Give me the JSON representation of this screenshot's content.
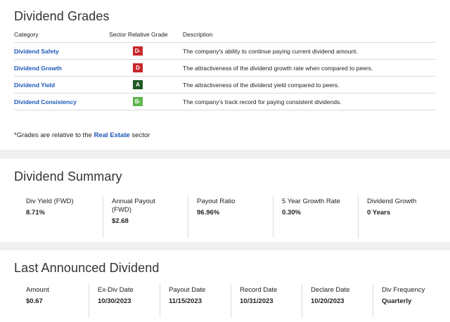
{
  "grades": {
    "title": "Dividend Grades",
    "headers": {
      "category": "Category",
      "grade": "Sector Relative Grade",
      "description": "Description"
    },
    "rows": [
      {
        "category": "Dividend Safety",
        "grade": "D-",
        "color": "#c8262b",
        "description": "The company's ability to continue paying current dividend amount."
      },
      {
        "category": "Dividend Growth",
        "grade": "D",
        "color": "#c8262b",
        "description": "The attractiveness of the dividend growth rate when compared to peers."
      },
      {
        "category": "Dividend Yield",
        "grade": "A",
        "color": "#1e5a23",
        "description": "The attractiveness of the dividend yield compared to peers."
      },
      {
        "category": "Dividend Consistency",
        "grade": "B-",
        "color": "#5bb64b",
        "description": "The company's track record for paying consistent dividends."
      }
    ],
    "note_prefix": "*Grades are relative to the ",
    "note_link": "Real Estate",
    "note_suffix": " sector"
  },
  "summary": {
    "title": "Dividend Summary",
    "items": [
      {
        "label": "Div Yield (FWD)",
        "value": "8.71%"
      },
      {
        "label": "Annual Payout (FWD)",
        "value": "$2.68"
      },
      {
        "label": "Payout Ratio",
        "value": "96.96%"
      },
      {
        "label": "5 Year Growth Rate",
        "value": "0.30%"
      },
      {
        "label": "Dividend Growth",
        "value": "0 Years"
      }
    ]
  },
  "last": {
    "title": "Last Announced Dividend",
    "items": [
      {
        "label": "Amount",
        "value": "$0.67"
      },
      {
        "label": "Ex-Div Date",
        "value": "10/30/2023"
      },
      {
        "label": "Payout Date",
        "value": "11/15/2023"
      },
      {
        "label": "Record Date",
        "value": "10/31/2023"
      },
      {
        "label": "Declare Date",
        "value": "10/20/2023"
      },
      {
        "label": "Div Frequency",
        "value": "Quarterly"
      }
    ]
  }
}
